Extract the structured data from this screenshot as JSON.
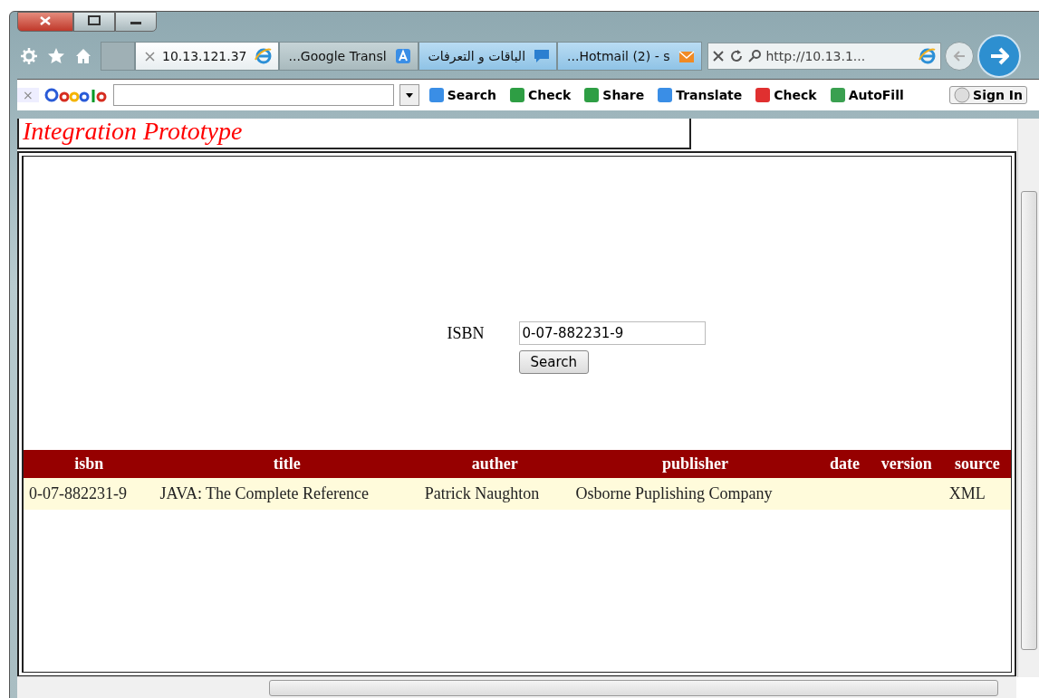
{
  "tabs": [
    {
      "label": "10.13.121.37",
      "selected": true
    },
    {
      "label": "...Google Transl",
      "selected": false
    },
    {
      "label": "الباقات و التعرفات",
      "selected": false
    },
    {
      "label": "...Hotmail (2) - s",
      "selected": false
    }
  ],
  "address": {
    "value": "http://10.13.1..."
  },
  "google_toolbar": {
    "close": "×",
    "buttons": [
      "Search",
      "Check",
      "Share",
      "Translate",
      "Check",
      "AutoFill",
      "Sign In"
    ]
  },
  "page": {
    "banner": "Integration Prototype",
    "search": {
      "label": "ISBN",
      "value": "0-07-882231-9",
      "button": "Search"
    },
    "table": {
      "columns": [
        "isbn",
        "title",
        "auther",
        "publisher",
        "date",
        "version",
        "source"
      ],
      "rows": [
        [
          "0-07-882231-9",
          "JAVA: The Complete Reference",
          "Patrick Naughton",
          "Osborne Puplishing Company",
          "",
          "",
          "XML"
        ]
      ]
    }
  }
}
